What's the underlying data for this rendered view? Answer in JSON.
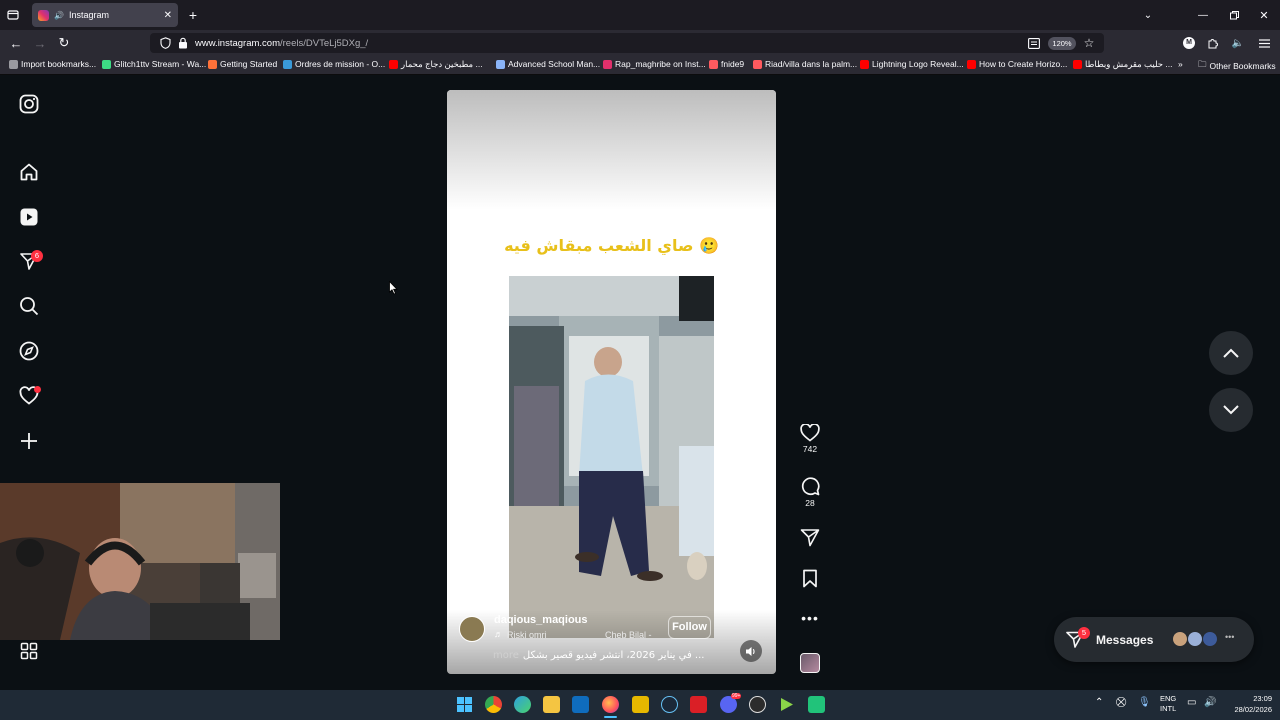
{
  "browser": {
    "tab_title": "Instagram",
    "url_host": "www.instagram.com",
    "url_path": "/reels/DVTeLj5DXg_/",
    "zoom": "120%",
    "profile_initial": "M",
    "bookmarks": [
      {
        "label": "Import bookmarks...",
        "color": "#9a9aa0"
      },
      {
        "label": "Glitch1ttv Stream - Wa...",
        "color": "#3ddc84"
      },
      {
        "label": "Getting Started",
        "color": "#ff7139"
      },
      {
        "label": "Ordres de mission - O...",
        "color": "#3a9ad9"
      },
      {
        "label": "مطبخين دجاج محمار ...",
        "color": "#ff0000"
      },
      {
        "label": "Advanced School Man...",
        "color": "#8ab4f8"
      },
      {
        "label": "Rap_maghribe on Inst...",
        "color": "#e1306c"
      },
      {
        "label": "fnide9",
        "color": "#ff5a5f"
      },
      {
        "label": "Riad/villa dans la palm...",
        "color": "#ff5a5f"
      },
      {
        "label": "Lightning Logo Reveal...",
        "color": "#ff0000"
      },
      {
        "label": "How to Create Horizo...",
        "color": "#ff0000"
      },
      {
        "label": "حليب مقرمش وبطاطا ...",
        "color": "#ff0000"
      }
    ],
    "other_bookmarks": "Other Bookmarks"
  },
  "sidebar": {
    "notifications_badge": "6"
  },
  "reel": {
    "overlay_text": "صاي الشعب مبقاش فيه 🥲",
    "username": "daqious_maqious",
    "audio": "Riski omri",
    "audio_right": "Cheb Bilal -",
    "follow_label": "Follow",
    "caption": "في يناير 2026، انتشر فيديو قصير بشكل ...",
    "more_label": "more",
    "likes": "742",
    "comments": "28"
  },
  "messages": {
    "label": "Messages",
    "badge": "5"
  },
  "taskbar": {
    "lang_top": "ENG",
    "lang_bottom": "INTL",
    "time": "23:09",
    "date": "28/02/2026",
    "discord_badge": "99+"
  },
  "colors": {
    "ig_badge": "#ff3040",
    "overlay_text": "#e8c01a"
  }
}
